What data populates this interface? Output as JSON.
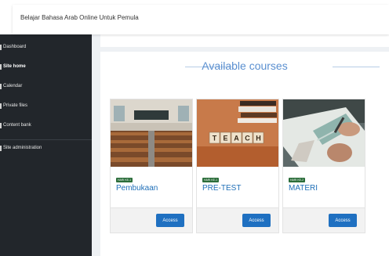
{
  "header": {
    "site_name": "Belajar Bahasa Arab Online Untuk Pemula"
  },
  "nav": {
    "items": [
      {
        "label": "Dashboard",
        "active": false,
        "icon": "dashboard-icon"
      },
      {
        "label": "Site home",
        "active": true,
        "icon": "home-icon"
      },
      {
        "label": "Calendar",
        "active": false,
        "icon": "calendar-icon"
      },
      {
        "label": "Private files",
        "active": false,
        "icon": "file-icon"
      },
      {
        "label": "Content bank",
        "active": false,
        "icon": "content-bank-icon"
      },
      {
        "label": "Site administration",
        "active": false,
        "icon": "wrench-icon"
      }
    ]
  },
  "main": {
    "section_title": "Available courses",
    "courses": [
      {
        "badge": "HARI KE-1",
        "title": "Pembukaan",
        "access_label": "Access",
        "image": "lecture-hall-image"
      },
      {
        "badge": "HARI KE-1",
        "title": "PRE-TEST",
        "access_label": "Access",
        "image": "teach-blocks-image"
      },
      {
        "badge": "HARI KE-2",
        "title": "MATERI",
        "access_label": "Access",
        "image": "writing-hand-image"
      }
    ]
  },
  "colors": {
    "sidebar_bg": "#22262b",
    "accent": "#5a8fd0",
    "button": "#1f70c1",
    "badge": "#2b6d3a"
  }
}
